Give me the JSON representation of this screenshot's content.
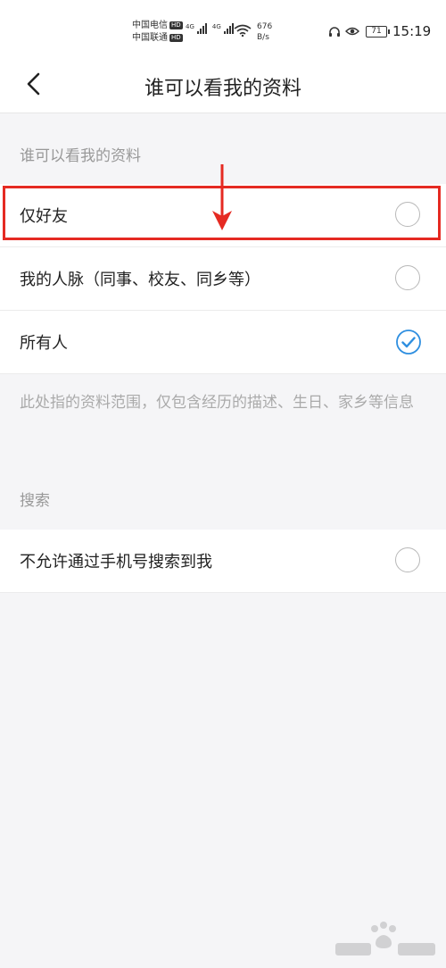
{
  "status_bar": {
    "carrier_1": "中国电信",
    "carrier_2": "中国联通",
    "hd_badge": "HD",
    "network_type": "4G",
    "speed_value": "676",
    "speed_unit": "B/s",
    "battery": "71",
    "time": "15:19"
  },
  "nav": {
    "title": "谁可以看我的资料"
  },
  "visibility_section": {
    "header": "谁可以看我的资料",
    "options": [
      {
        "label": "仅好友",
        "selected": false
      },
      {
        "label": "我的人脉（同事、校友、同乡等）",
        "selected": false
      },
      {
        "label": "所有人",
        "selected": true
      }
    ],
    "note": "此处指的资料范围，仅包含经历的描述、生日、家乡等信息"
  },
  "search_section": {
    "header": "搜索",
    "options": [
      {
        "label": "不允许通过手机号搜索到我",
        "selected": false
      }
    ]
  },
  "colors": {
    "accent": "#2f8fe0",
    "annotation": "#e52a22",
    "background": "#f5f5f7"
  }
}
